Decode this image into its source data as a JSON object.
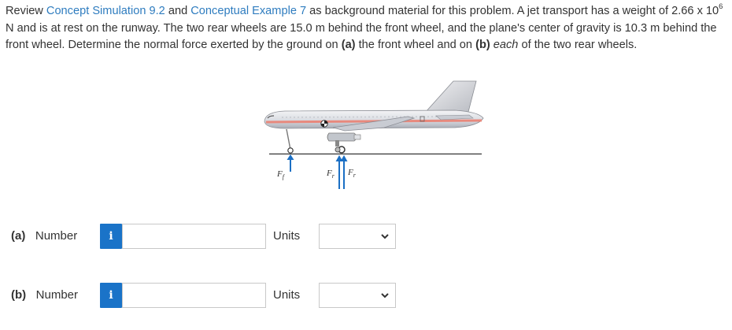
{
  "problem": {
    "intro": "Review ",
    "link1": "Concept Simulation 9.2",
    "and": " and ",
    "link2": "Conceptual Example 7",
    "text1": " as background material for this problem. A jet transport has a weight of 2.66 x 10",
    "exp": "6",
    "text2": " N and is at rest on the runway. The two rear wheels are 15.0 m behind the front wheel, and the plane's center of gravity is 10.3 m behind the front wheel. Determine the normal force exerted by the ground on ",
    "part_a": "(a)",
    "text3": " the front wheel and on ",
    "part_b": "(b)",
    "text4": " ",
    "each": "each",
    "text5": " of the two rear wheels."
  },
  "figure": {
    "label_front": "F",
    "label_front_sub": "f",
    "label_rear1": "F",
    "label_rear1_sub": "r",
    "label_rear2": "F",
    "label_rear2_sub": "r"
  },
  "answers": [
    {
      "part": "(a)",
      "label": "Number",
      "info_icon": "i",
      "value": "",
      "units_label": "Units",
      "units_value": ""
    },
    {
      "part": "(b)",
      "label": "Number",
      "info_icon": "i",
      "value": "",
      "units_label": "Units",
      "units_value": ""
    }
  ]
}
